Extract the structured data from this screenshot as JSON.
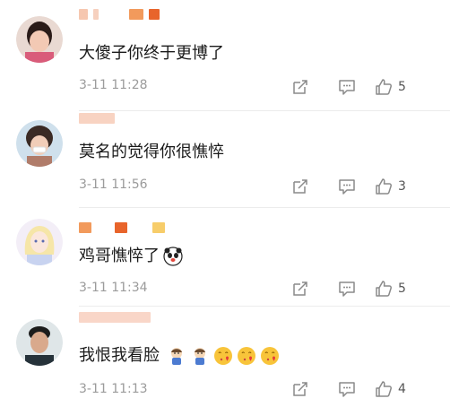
{
  "colors": {
    "name_orange": "#f29a5c",
    "name_red": "#e8642b",
    "name_yellow": "#f7cd6a",
    "icon_gray": "#8a8a8a",
    "time_gray": "#9b9b9b"
  },
  "comments": [
    {
      "text": "大傻子你终于更博了",
      "time": "3-11 11:28",
      "likes": "5",
      "emojis": []
    },
    {
      "text": "莫名的觉得你很憔悴",
      "time": "3-11 11:56",
      "likes": "3",
      "emojis": []
    },
    {
      "text": "鸡哥憔悴了",
      "time": "3-11 11:34",
      "likes": "5",
      "emojis": [
        "panda-icon"
      ]
    },
    {
      "text": "我恨我看脸",
      "time": "3-11 11:13",
      "likes": "4",
      "emojis": [
        "sad-baby-icon",
        "sad-baby-icon",
        "heart-kiss-face-icon",
        "heart-kiss-face-icon",
        "heart-kiss-face-icon"
      ]
    }
  ]
}
